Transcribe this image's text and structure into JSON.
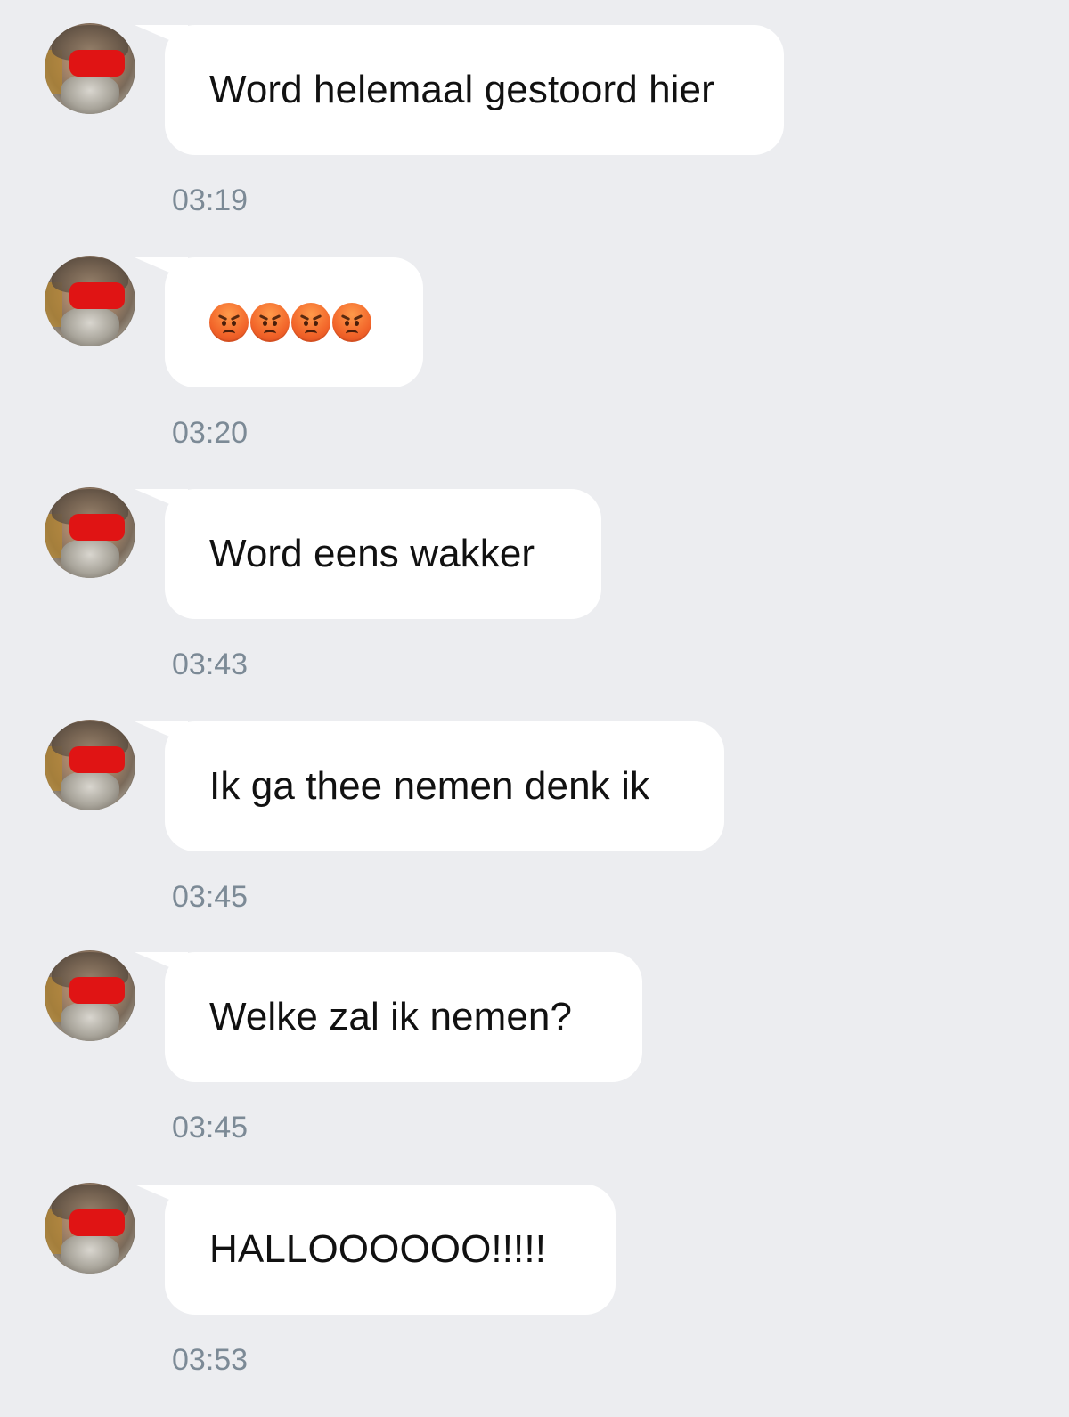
{
  "messages": [
    {
      "text": "Word helemaal gestoord hier",
      "time": "03:19"
    },
    {
      "emoji": [
        "angry-face",
        "angry-face",
        "angry-face",
        "angry-face"
      ],
      "time": "03:20"
    },
    {
      "text": "Word eens wakker",
      "time": "03:43"
    },
    {
      "text": "Ik ga thee nemen denk ik",
      "time": "03:45"
    },
    {
      "text": "Welke zal ik nemen?",
      "time": "03:45"
    },
    {
      "text": "HALLOOOOOO!!!!!",
      "time": "03:53"
    }
  ],
  "colors": {
    "background": "#ecedf0",
    "bubble": "#ffffff",
    "text": "#111111",
    "timestamp": "#7c8a96",
    "censor": "#e01414"
  }
}
